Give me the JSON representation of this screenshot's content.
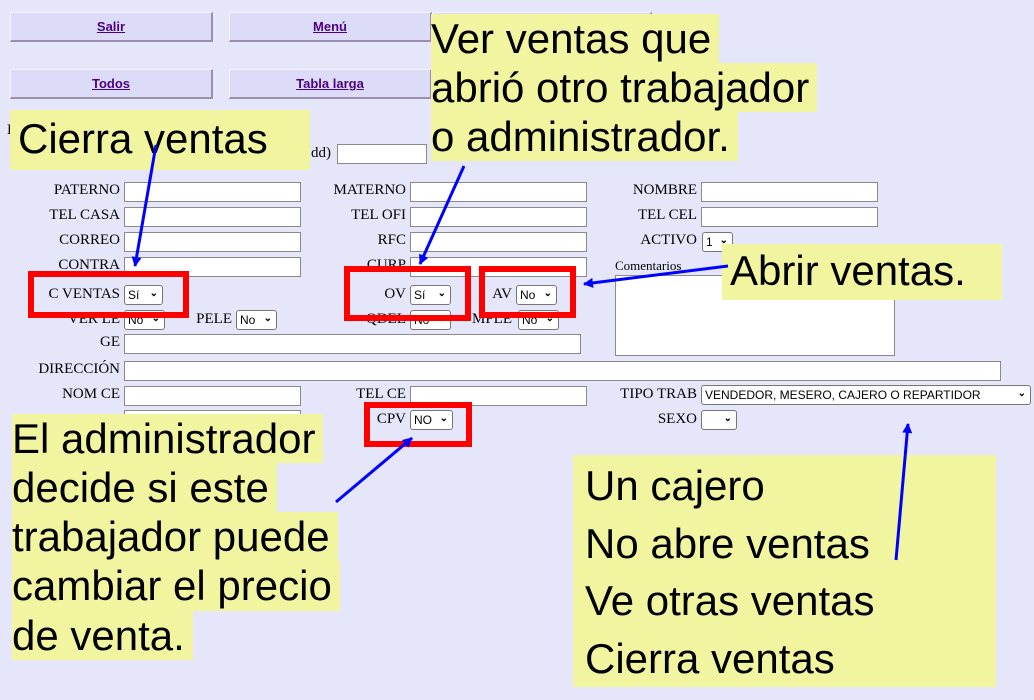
{
  "nav": {
    "salir": "Salir",
    "menu": "Menú",
    "todos": "Todos",
    "tabla_larga": "Tabla larga"
  },
  "fragments": {
    "h": "H",
    "i": "I",
    "dd": "dd)"
  },
  "form": {
    "paterno": "PATERNO",
    "materno": "MATERNO",
    "nombre": "NOMBRE",
    "tel_casa": "TEL CASA",
    "tel_ofi": "TEL OFI",
    "tel_cel": "TEL CEL",
    "correo": "CORREO",
    "rfc": "RFC",
    "activo": "ACTIVO",
    "activo_value": "1",
    "contra": "CONTRA",
    "curp": "CURP",
    "comentarios": "Comentarios",
    "c_ventas": "C VENTAS",
    "c_ventas_value": "Sí",
    "ov": "OV",
    "ov_value": "Sí",
    "av": "AV",
    "av_value": "No",
    "ver_le": "VER LE",
    "ver_le_value": "No",
    "pele": "PELE",
    "pele_value": "No",
    "qdel": "QDEL",
    "qdel_value": "No",
    "mple": "MPLE",
    "mple_value": "No",
    "ge": "GE",
    "direccion": "DIRECCIÓN",
    "nom_ce": "NOM CE",
    "tel_ce": "TEL CE",
    "tipo_trab": "TIPO TRAB",
    "tipo_trab_value": "VENDEDOR, MESERO, CAJERO O REPARTIDOR",
    "cpv": "CPV",
    "cpv_value": "NO",
    "sexo": "SEXO",
    "sexo_value": ""
  },
  "annotations": {
    "cierra": "Cierra ventas",
    "ver_ventas": [
      "Ver ventas que",
      "abrió otro trabajador",
      "o administrador."
    ],
    "abrir": "Abrir ventas.",
    "admin": [
      "El administrador",
      "decide si este",
      "trabajador puede",
      "cambiar el precio",
      "de venta."
    ],
    "cajero": [
      "Un cajero",
      "No abre ventas",
      "Ve otras ventas",
      "Cierra ventas"
    ]
  },
  "colors": {
    "background": "#e6e6fa",
    "note_bg": "#f1f5a0",
    "highlight": "#ff0000",
    "arrow": "#0000ff",
    "link": "#4b0082"
  }
}
